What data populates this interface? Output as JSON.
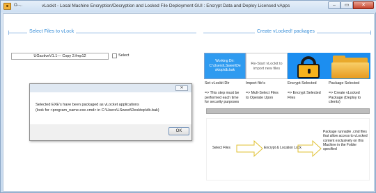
{
  "window": {
    "title_left": "O--..",
    "title": "vLockit - Local Machine Encryption/Decryption and Locked File Deployment GUI : Encrypt Data and Deploy Licensed vApps",
    "controls": {
      "minimize": "–",
      "maximize": "▭",
      "close": "✕"
    }
  },
  "left_section": {
    "title": "Select Files to vLock",
    "file_name": "UGactiveV1.1--- Copy 2.fmp12",
    "checkbox_label": "Select"
  },
  "right_section": {
    "title": "Create vLocked! packages",
    "tiles": [
      {
        "text": "Working Dir:\nC:\\Users\\LSweet\\De\nsktop\\db.bak",
        "label": "Set vLockit Dir",
        "desc": "=> This step must be\nperformed each time\nfor security purposes"
      },
      {
        "text": "Re-Start vLockit to\nimport new files",
        "label": "Import file's",
        "desc": "=> Mult-Select Files\nto Operate Upon"
      },
      {
        "text": "",
        "label": "Encrypt Selected",
        "desc": "=> Encrypt Selected\nFiles",
        "icon": "padlock-icon"
      },
      {
        "text": "",
        "label": "Package Selected",
        "desc": "=> Create vLocked\nPackage (Deploy to\nclients)",
        "icon": "folder-icon"
      }
    ],
    "flow": {
      "step1": "Select Files",
      "step2": "Encrypt & Location Lock",
      "step3": "Package runnable .cmd files\nthat allow access to vLocked\ncontent exclusively on this\nMachine in the Folder\nspecified"
    }
  },
  "dialog": {
    "close_label": "✕",
    "message_line1": "Selected EXE's have been packaged as vLocket applications",
    "message_line2": "(look for <program_name.exe.cmd> in C:\\Users\\LSweet\\Desktop\\db.bak)",
    "ok_label": "OK"
  },
  "colors": {
    "accent": "#3a8fd8",
    "tile_blue": "#2f9bf0",
    "lock_gold": "#f6b21c"
  }
}
